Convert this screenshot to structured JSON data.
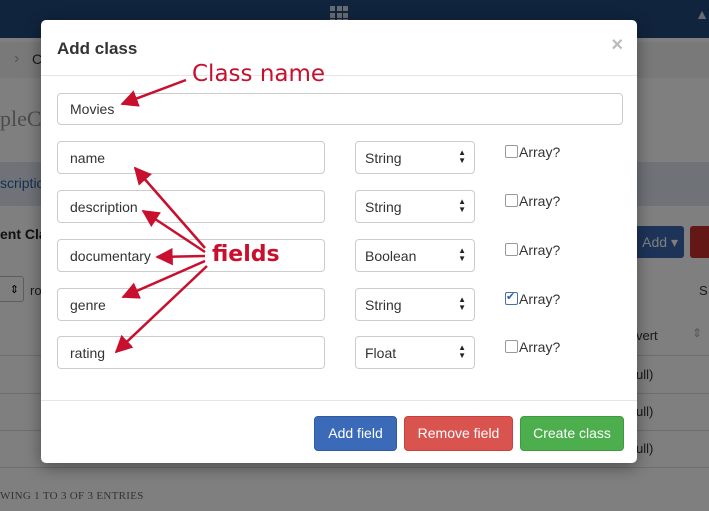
{
  "background": {
    "breadcrumb_fragment": "C",
    "app_name_fragment": "pleC",
    "description_fragment": "scription",
    "section_title_fragment": "ent Cla",
    "add_button_label": "Add",
    "rows_fragment": "ro",
    "s_fragment": "S",
    "column_header_fragment": "vert",
    "null_values": [
      "ull)",
      "ull)",
      "ull)"
    ],
    "footer_text": "WING 1 TO 3 OF 3 ENTRIES"
  },
  "modal": {
    "title": "Add class",
    "close_icon": "×",
    "class_name_value": "Movies",
    "fields": [
      {
        "name": "name",
        "type": "String",
        "array_label": "Array?",
        "is_array": false
      },
      {
        "name": "description",
        "type": "String",
        "array_label": "Array?",
        "is_array": false
      },
      {
        "name": "documentary",
        "type": "Boolean",
        "array_label": "Array?",
        "is_array": false
      },
      {
        "name": "genre",
        "type": "String",
        "array_label": "Array?",
        "is_array": true
      },
      {
        "name": "rating",
        "type": "Float",
        "array_label": "Array?",
        "is_array": false
      }
    ],
    "buttons": {
      "add_field": "Add field",
      "remove_field": "Remove field",
      "create_class": "Create class"
    }
  },
  "annotations": {
    "class_name_label": "Class name",
    "fields_label": "fields",
    "color": "#c8102e"
  },
  "colors": {
    "topbar": "#23487a",
    "primary": "#3a6ab8",
    "danger": "#d9534f",
    "success": "#4cae4c"
  }
}
